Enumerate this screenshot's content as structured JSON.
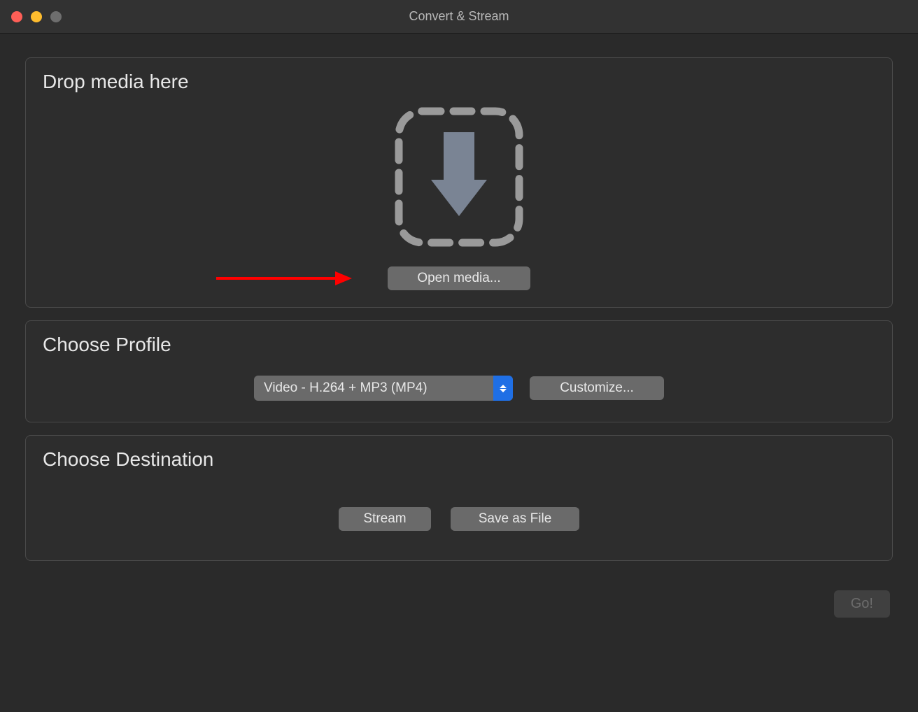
{
  "window": {
    "title": "Convert & Stream"
  },
  "drop": {
    "title": "Drop media here",
    "open_button": "Open media..."
  },
  "profile": {
    "title": "Choose Profile",
    "selected": "Video - H.264 + MP3 (MP4)",
    "customize_button": "Customize..."
  },
  "destination": {
    "title": "Choose Destination",
    "stream_button": "Stream",
    "save_button": "Save as File"
  },
  "footer": {
    "go_button": "Go!"
  }
}
